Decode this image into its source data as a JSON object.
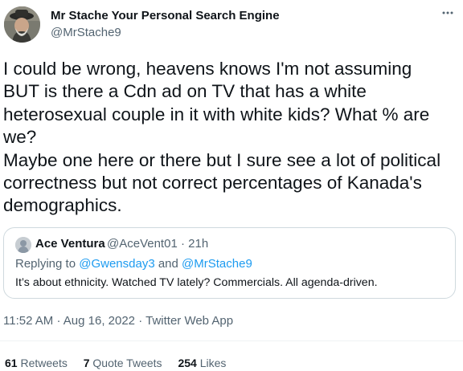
{
  "author": {
    "display_name": "Mr Stache Your Personal Search Engine",
    "handle": "@MrStache9"
  },
  "tweet": {
    "lines": [
      "I could be wrong, heavens knows I'm not assuming",
      "BUT is there a Cdn ad on TV that has a white",
      "heterosexual couple in it with white kids? What % are",
      "we?",
      "Maybe one here or there but I sure see a lot of political",
      "correctness but not correct percentages of Kanada's",
      "demographics."
    ]
  },
  "quote": {
    "name": "Ace Ventura",
    "handle": "@AceVent01",
    "separator": "·",
    "age": "21h",
    "replying_prefix": "Replying to",
    "mention_1": "@Gwensday3",
    "replying_and": "and",
    "mention_2": "@MrStache9",
    "text": "It’s about ethnicity. Watched TV lately? Commercials. All agenda-driven."
  },
  "meta": {
    "time": "11:52 AM",
    "date": "Aug 16, 2022",
    "source": "Twitter Web App",
    "separator": "·"
  },
  "stats": {
    "retweets_count": "61",
    "retweets_label": "Retweets",
    "quotes_count": "7",
    "quotes_label": "Quote Tweets",
    "likes_count": "254",
    "likes_label": "Likes"
  },
  "icons": {
    "more": "more-horizontal-icon"
  },
  "colors": {
    "text_primary": "#0f1419",
    "text_secondary": "#536471",
    "link": "#1d9bf0",
    "border": "#cfd9de"
  }
}
